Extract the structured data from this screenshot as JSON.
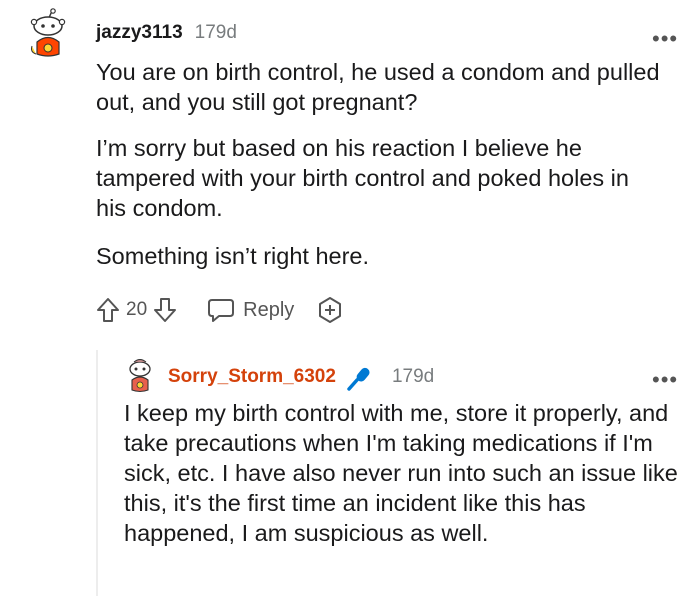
{
  "comment": {
    "username": "jazzy3113",
    "age": "179d",
    "paragraphs": [
      "You are on birth control, he used a condom and pulled out, and you still got pregnant?",
      "I’m sorry but based on his reaction I believe he tampered with your birth control and poked holes in his condom.",
      "Something isn’t right here."
    ],
    "votes": "20",
    "reply_label": "Reply",
    "more_label": "•••"
  },
  "reply": {
    "username": "Sorry_Storm_6302",
    "age": "179d",
    "text": "I keep my birth control with me, store it properly, and take precautions when I'm taking medications if I'm sick, etc. I have also never run into such an issue like this, it's the first time an incident like this has happened, I am suspicious as well.",
    "more_label": "•••",
    "op_badge_color": "#0079d3"
  },
  "colors": {
    "accent": "#d4420b",
    "meta_gray": "#787c7e",
    "thread_line": "#ededed"
  },
  "icons": [
    "avatar-snoo",
    "upvote-icon",
    "downvote-icon",
    "reply-bubble-icon",
    "award-icon",
    "microphone-icon",
    "more-icon"
  ]
}
